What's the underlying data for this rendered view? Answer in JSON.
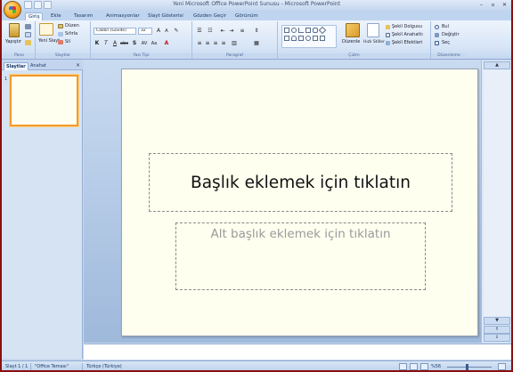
{
  "window": {
    "title": "Yeni Microsoft Office PowerPoint Sunusu - Microsoft PowerPoint",
    "controls": [
      "–",
      "▫",
      "✕"
    ]
  },
  "ribbon_tabs": [
    "Giriş",
    "Ekle",
    "Tasarım",
    "Animasyonlar",
    "Slayt Gösterisi",
    "Gözden Geçir",
    "Görünüm"
  ],
  "ribbon": {
    "clipboard": {
      "paste": "Yapıştır",
      "label": "Pano"
    },
    "slides": {
      "new_slide": "Yeni Slayt",
      "layout": "Düzen",
      "reset": "Sıfırla",
      "delete": "Sil",
      "label": "Slaytlar"
    },
    "font": {
      "font_name": "Calibri (Gövde)",
      "font_size": "32",
      "label": "Yazı Tipi"
    },
    "paragraph": {
      "label": "Paragraf"
    },
    "drawing": {
      "arrange": "Düzenle",
      "quick_styles": "Hızlı Stiller",
      "shape_fill": "Şekil Dolgusu",
      "shape_outline": "Şekil Anahattı",
      "shape_effects": "Şekil Efektleri",
      "label": "Çizim"
    },
    "editing": {
      "find": "Bul",
      "replace": "Değiştir",
      "select": "Seç",
      "label": "Düzenleme"
    }
  },
  "left_pane": {
    "tabs": [
      "Slaytlar",
      "Anahat"
    ],
    "close": "×",
    "slide_number": "1"
  },
  "slide": {
    "title_placeholder": "Başlık eklemek için tıklatın",
    "subtitle_placeholder": "Alt başlık eklemek için tıklatın"
  },
  "status_bar": {
    "slide_info": "Slayt 1 / 1",
    "theme": "\"Office Teması\"",
    "language": "Türkçe (Türkiye)",
    "zoom": "%56"
  },
  "colors": {
    "office_button": "#f6a41d",
    "selected_thumbnail": "#f29a2b",
    "slide_background": "#fffff0",
    "ribbon": "#d7e5f6"
  }
}
